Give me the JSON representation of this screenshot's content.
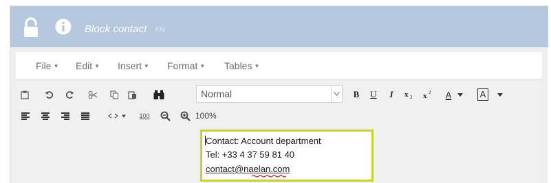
{
  "window": {
    "title": "Block contact",
    "lang": "FN"
  },
  "menubar": {
    "items": [
      {
        "label": "File"
      },
      {
        "label": "Edit"
      },
      {
        "label": "Insert"
      },
      {
        "label": "Format"
      },
      {
        "label": "Tables"
      }
    ]
  },
  "toolbar": {
    "format_select_value": "Normal",
    "zoom_reset_label": "100",
    "zoom_percent": "100%",
    "underline_label": "U",
    "italic_label": "I",
    "bold_label": "B",
    "text_color_label": "A",
    "bg_color_label": "A"
  },
  "content": {
    "line1": "Contact: Account department",
    "line2": "Tel: +33 4 37 59 81 40",
    "line3": "contact@naelan.com"
  },
  "colors": {
    "titlebar": "#b6c8de",
    "highlight_border": "#c5d22b",
    "spell_error": "#d11a1a"
  },
  "icons": {
    "lock": "lock-icon",
    "info": "info-icon",
    "paste": "paste-icon",
    "undo": "undo-icon",
    "redo": "redo-icon",
    "cut": "cut-icon",
    "copy": "copy-icon",
    "paste_text": "paste-text-icon",
    "find": "binoculars-icon"
  }
}
